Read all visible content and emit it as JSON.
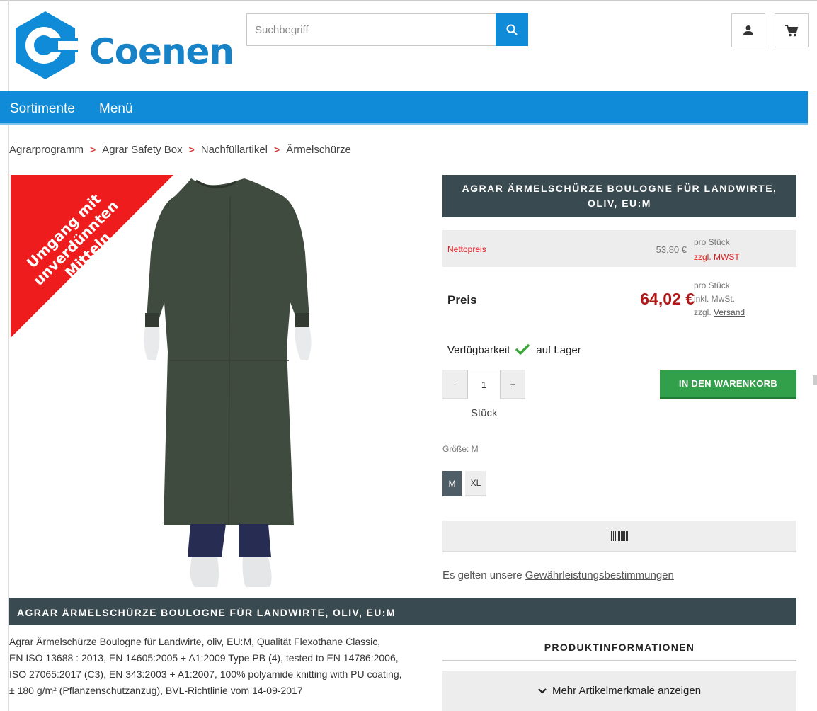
{
  "header": {
    "logo_text": "Coenen",
    "search_placeholder": "Suchbegriff"
  },
  "nav": {
    "items": [
      "Sortimente",
      "Menü"
    ]
  },
  "breadcrumb": [
    "Agrarprogramm",
    "Agrar Safety Box",
    "Nachfüllartikel",
    "Ärmelschürze"
  ],
  "badge": {
    "lines": [
      "Umgang mit",
      "unverdünnten",
      "Mitteln"
    ]
  },
  "product": {
    "title_line1": "AGRAR ÄRMELSCHÜRZE BOULOGNE FÜR LANDWIRTE,",
    "title_line2": "OLIV, EU:M",
    "net_label": "Nettopreis",
    "net_price": "53,80 €",
    "net_unit": "pro Stück",
    "net_tax": "zzgl. MWST",
    "price_label": "Preis",
    "price": "64,02 €",
    "price_unit": "pro Stück",
    "price_tax": "inkl. MwSt.",
    "shipping_prefix": "zzgl.",
    "shipping_link": "Versand",
    "availability_label": "Verfügbarkeit",
    "availability_value": "auf Lager",
    "qty_minus": "-",
    "qty_value": "1",
    "qty_plus": "+",
    "qty_unit": "Stück",
    "cart_button": "IN DEN WARENKORB",
    "size_label": "Größe: M",
    "sizes": [
      "M",
      "XL"
    ],
    "warranty_prefix": "Es gelten unsere",
    "warranty_link": "Gewährleistungsbestimmungen"
  },
  "description": {
    "heading": "AGRAR ÄRMELSCHÜRZE BOULOGNE FÜR LANDWIRTE, OLIV, EU:M",
    "lines": [
      "Agrar Ärmelschürze Boulogne für Landwirte, oliv, EU:M, Qualität Flexothane Classic,",
      "EN ISO 13688 : 2013, EN 14605:2005 + A1:2009 Type PB (4), tested to EN 14786:2006,",
      "ISO 27065:2017 (C3), EN 343:2003 + A1:2007, 100% polyamide knitting with PU coating,",
      "± 180 g/m² (Pflanzenschutzanzug), BVL-Richtlinie vom 14-09-2017"
    ],
    "info_title": "PRODUKTINFORMATIONEN",
    "more_button": "Mehr Artikelmerkmale anzeigen"
  },
  "colors": {
    "brand_blue": "#0f8bd8",
    "dark_header": "#3a4a51",
    "price_red": "#b01818",
    "cart_green": "#32a04a",
    "badge_red": "#ee1c1c"
  },
  "icons": {
    "search": "search-icon",
    "account": "user-icon",
    "cart": "shopping-cart-icon",
    "available": "checkmark-icon",
    "barcode": "barcode-icon",
    "expand": "chevron-down-icon"
  }
}
